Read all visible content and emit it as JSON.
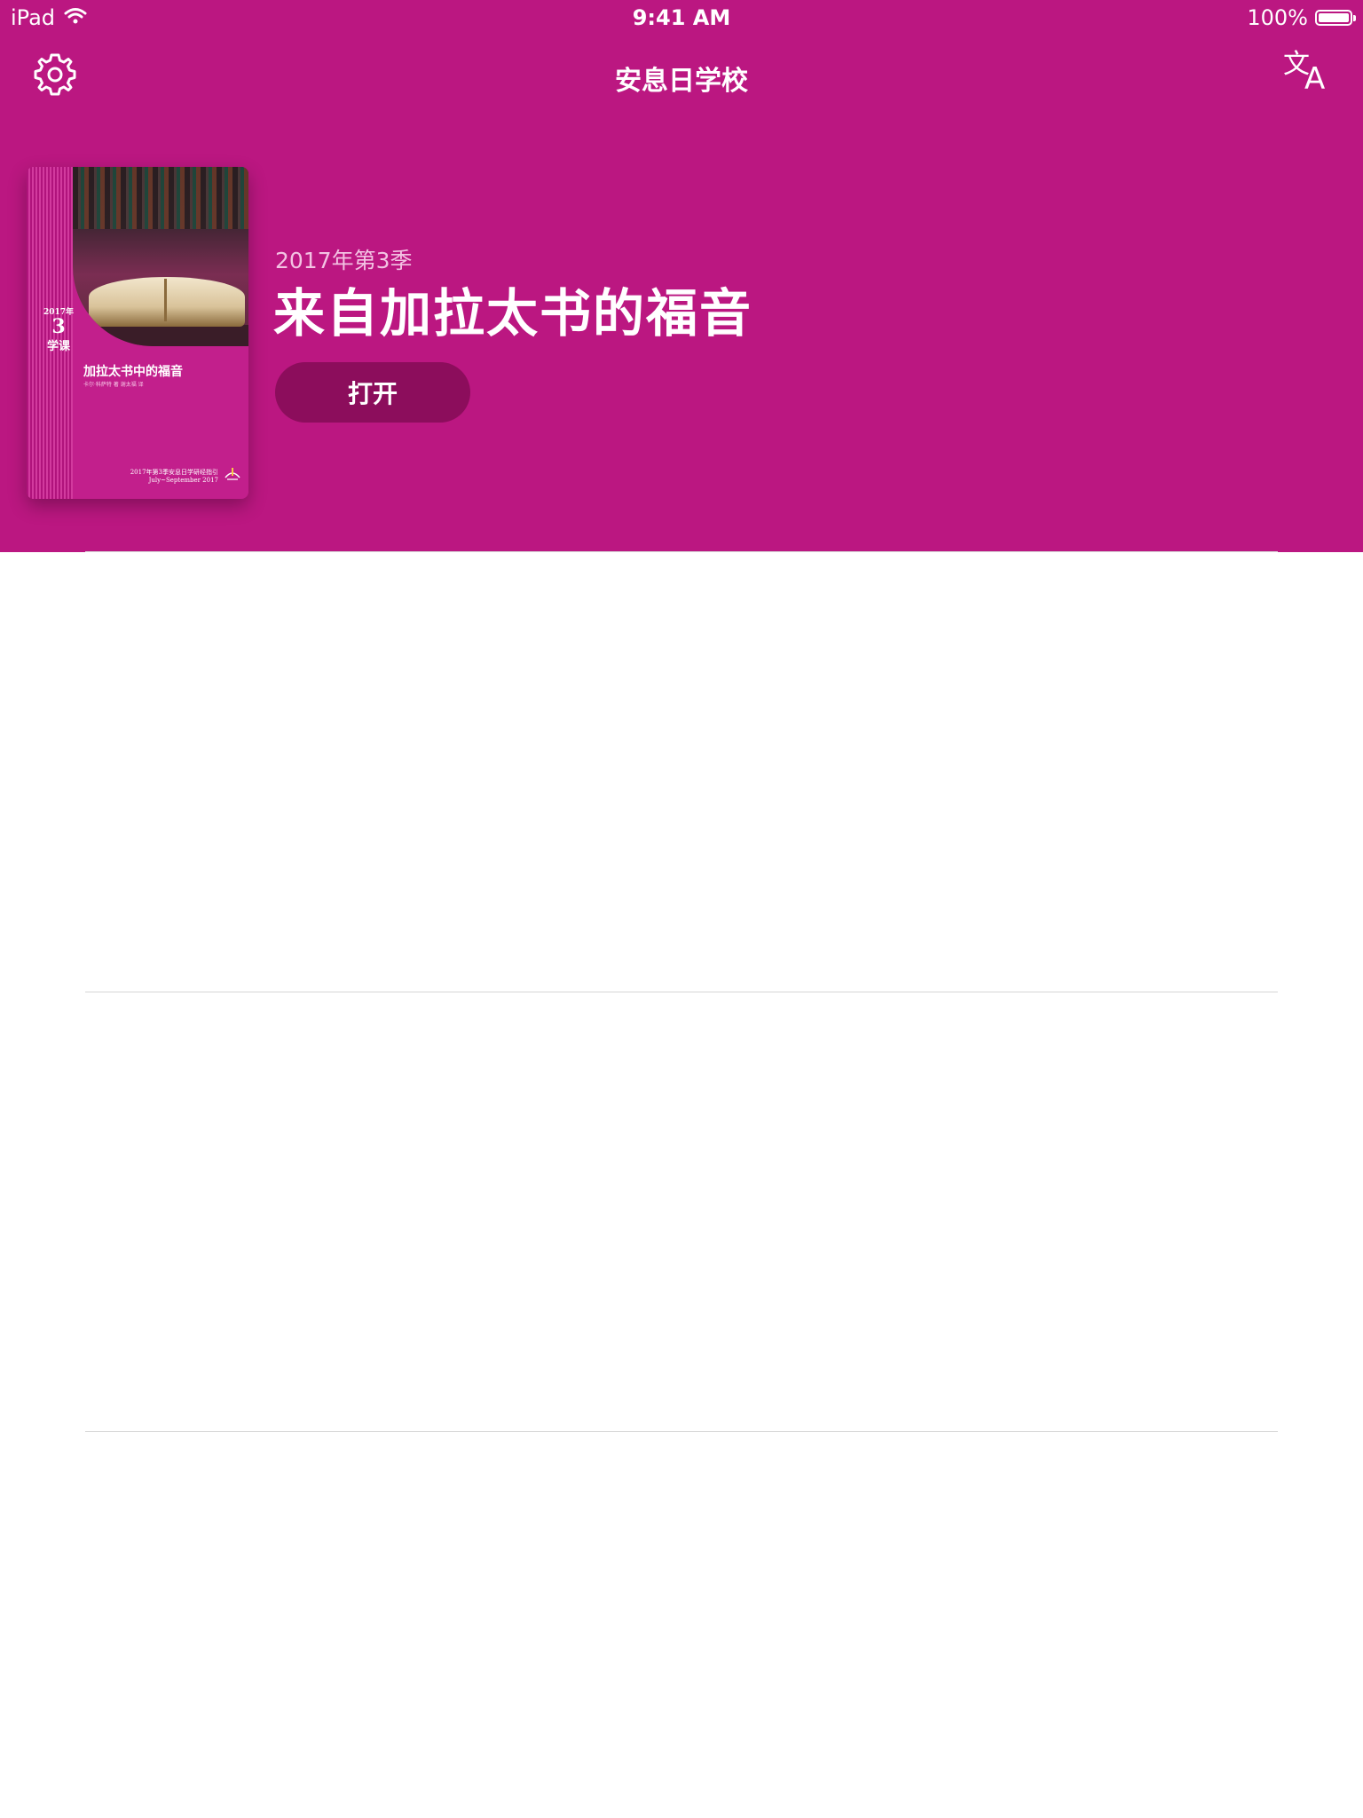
{
  "status_bar": {
    "device": "iPad",
    "time": "9:41 AM",
    "battery": "100%"
  },
  "nav": {
    "title": "安息日学校",
    "settings_icon": "gear-icon",
    "language_icon": "translate-icon",
    "language_glyph_a": "文",
    "language_glyph_b": "A"
  },
  "featured": {
    "quarter": "2017年第3季",
    "title": "来自加拉太书的福音",
    "open_label": "打开",
    "cover": {
      "year_label": "2017年",
      "quarter_num": "3",
      "lesson_label": "学课",
      "title": "加拉太书中的福音",
      "authors": "卡尔·科萨特 著  谢太福 译",
      "footer_line1": "2017年第3季安息日学研经指引",
      "footer_line2": "July~September 2017"
    }
  },
  "colors": {
    "hero_background": "#bb1781",
    "button_background": "#8c0d5c"
  }
}
